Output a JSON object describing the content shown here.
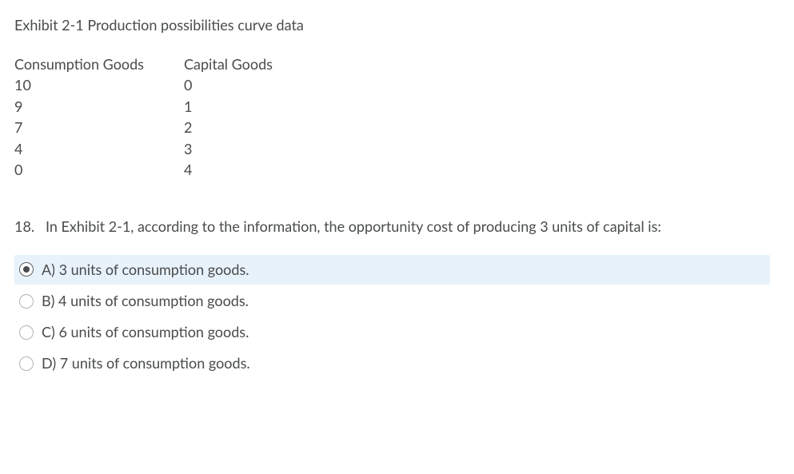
{
  "exhibit_title": "Exhibit 2-1 Production possibilities curve data",
  "table": {
    "header": {
      "col1": "Consumption Goods",
      "col2": "Capital Goods"
    },
    "rows": [
      {
        "col1": "10",
        "col2": "0"
      },
      {
        "col1": "9",
        "col2": "1"
      },
      {
        "col1": "7",
        "col2": "2"
      },
      {
        "col1": "4",
        "col2": "3"
      },
      {
        "col1": "0",
        "col2": "4"
      }
    ]
  },
  "question": {
    "number": "18.",
    "text": "In Exhibit 2-1, according to the information, the opportunity cost of producing 3 units of capital is:"
  },
  "options": [
    {
      "label": "A) 3 units of consumption goods.",
      "selected": true
    },
    {
      "label": "B) 4 units of consumption goods.",
      "selected": false
    },
    {
      "label": "C) 6 units of consumption goods.",
      "selected": false
    },
    {
      "label": "D) 7 units of consumption goods.",
      "selected": false
    }
  ]
}
